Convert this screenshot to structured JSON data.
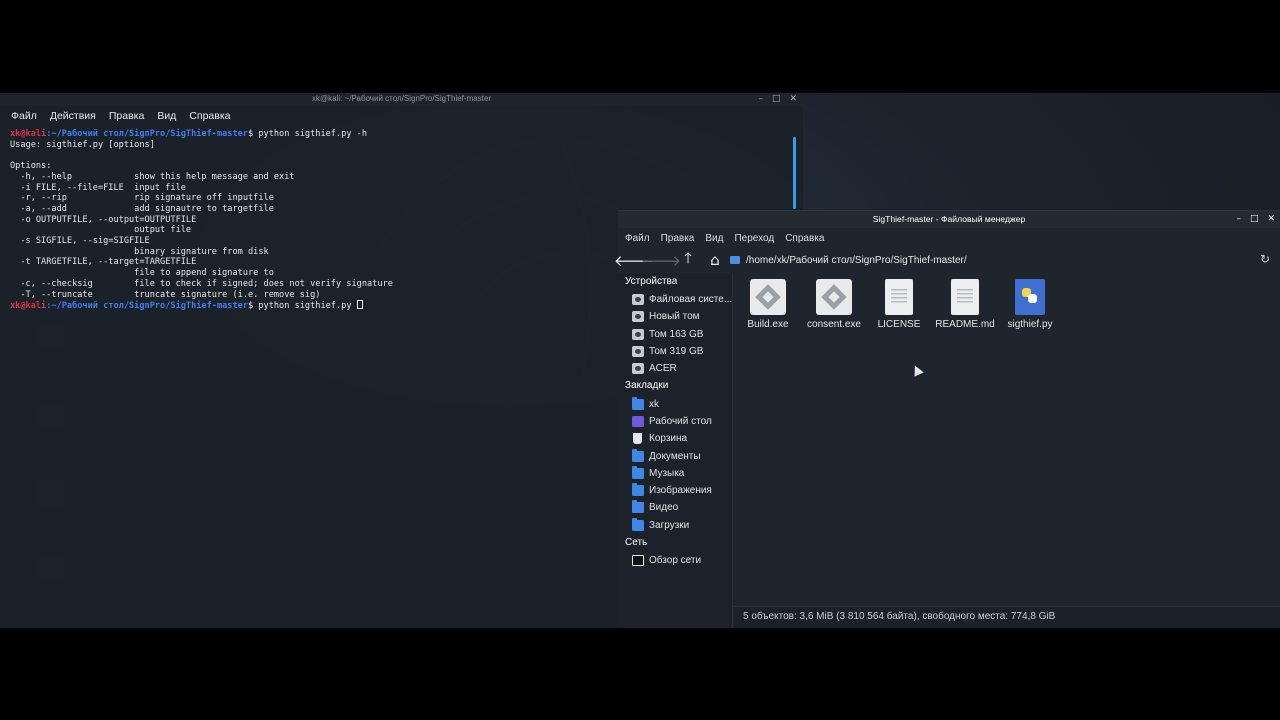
{
  "terminal": {
    "title": "xk@kali: ~/Рабочий стол/SignPro/SigThief-master",
    "menu": [
      "Файл",
      "Действия",
      "Правка",
      "Вид",
      "Справка"
    ],
    "prompt_user": "xk@kali",
    "prompt_path": ":~/Рабочий стол/SignPro/SigThief-master",
    "prompt_symbol": "$",
    "command_1": " python sigthief.py -h",
    "output": "Usage: sigthief.py [options]\n\nOptions:\n  -h, --help            show this help message and exit\n  -i FILE, --file=FILE  input file\n  -r, --rip             rip signature off inputfile\n  -a, --add             add signautre to targetfile\n  -o OUTPUTFILE, --output=OUTPUTFILE\n                        output file\n  -s SIGFILE, --sig=SIGFILE\n                        binary signature from disk\n  -t TARGETFILE, --target=TARGETFILE\n                        file to append signature to\n  -c, --checksig        file to check if signed; does not verify signature\n  -T, --truncate        truncate signature (i.e. remove sig)",
    "command_2": " python sigthief.py "
  },
  "file_manager": {
    "title": "SigThief-master - Файловый менеджер",
    "menu": [
      "Файл",
      "Правка",
      "Вид",
      "Переход",
      "Справка"
    ],
    "path": "/home/xk/Рабочий стол/SignPro/SigThief-master/",
    "sidebar": {
      "devices_heading": "Устройства",
      "devices": [
        {
          "label": "Файловая систе...",
          "icon": "drive-icon"
        },
        {
          "label": "Новый том",
          "icon": "drive-icon"
        },
        {
          "label": "Том 163 GB",
          "icon": "drive-icon"
        },
        {
          "label": "Том 319 GB",
          "icon": "drive-icon"
        },
        {
          "label": "ACER",
          "icon": "drive-icon"
        }
      ],
      "bookmarks_heading": "Закладки",
      "bookmarks": [
        {
          "label": "xk",
          "icon": "home-folder-icon"
        },
        {
          "label": "Рабочий стол",
          "icon": "desktop-folder-icon"
        },
        {
          "label": "Корзина",
          "icon": "trash-icon"
        },
        {
          "label": "Документы",
          "icon": "documents-folder-icon"
        },
        {
          "label": "Музыка",
          "icon": "music-folder-icon"
        },
        {
          "label": "Изображения",
          "icon": "pictures-folder-icon"
        },
        {
          "label": "Видео",
          "icon": "videos-folder-icon"
        },
        {
          "label": "Загрузки",
          "icon": "downloads-folder-icon"
        }
      ],
      "network_heading": "Сеть",
      "network": [
        {
          "label": "Обзор сети",
          "icon": "network-icon"
        }
      ]
    },
    "files": [
      {
        "name": "Build.exe",
        "type": "exe"
      },
      {
        "name": "consent.exe",
        "type": "exe"
      },
      {
        "name": "LICENSE",
        "type": "doc"
      },
      {
        "name": "README.md",
        "type": "doc"
      },
      {
        "name": "sigthief.py",
        "type": "py"
      }
    ],
    "status": "5 объектов: 3,6 MiB (3 810 564 байта), свободного места: 774,8 GiB"
  },
  "colors": {
    "prompt_user": "#e0304a",
    "prompt_path": "#3f7ff0",
    "accent": "#3b9be8"
  }
}
